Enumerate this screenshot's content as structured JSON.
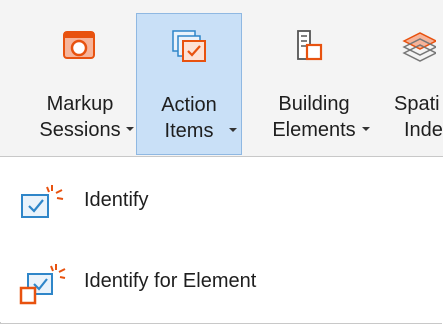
{
  "ribbon": {
    "buttons": [
      {
        "line1": "Markup",
        "line2": "Sessions",
        "icon": "markup-sessions-icon"
      },
      {
        "line1": "Action",
        "line2": "Items",
        "icon": "action-items-icon"
      },
      {
        "line1": "Building",
        "line2": "Elements",
        "icon": "building-elements-icon"
      },
      {
        "line1": "Spati",
        "line2": "Inde",
        "icon": "spatial-index-icon"
      }
    ]
  },
  "menu": {
    "items": [
      {
        "label": "Identify",
        "icon": "identify-icon"
      },
      {
        "label": "Identify for Element",
        "icon": "identify-for-element-icon"
      }
    ]
  },
  "colors": {
    "accent_orange": "#e8520f",
    "accent_blue": "#2f86c9",
    "active_bg": "#c9e0f7",
    "active_border": "#8fb8e2"
  }
}
